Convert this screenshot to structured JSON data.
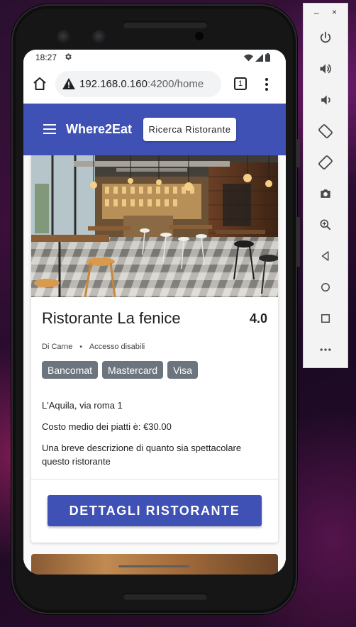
{
  "status_bar": {
    "time": "18:27"
  },
  "browser": {
    "url_host": "192.168.0.160",
    "url_path": ":4200/home",
    "tab_count": "1"
  },
  "app": {
    "title": "Where2Eat",
    "search_button": "Ricerca Ristorante"
  },
  "restaurant": {
    "name": "Ristorante La fenice",
    "rating": "4.0",
    "category": "Di Carne",
    "separator": "•",
    "accessibility": "Accesso disabili",
    "payments": [
      "Bancomat",
      "Mastercard",
      "Visa"
    ],
    "address": "L'Aquila, via roma 1",
    "average_cost": "Costo medio dei piatti è: €30.00",
    "description": "Una breve descrizione di quanto sia spettacolare questo ristorante",
    "details_button": "DETTAGLI RISTORANTE"
  },
  "emulator": {
    "minimize": "–",
    "close": "×",
    "buttons": [
      "power-icon",
      "volume-up-icon",
      "volume-down-icon",
      "rotate-left-icon",
      "rotate-right-icon",
      "camera-icon",
      "zoom-icon",
      "back-icon",
      "home-icon",
      "overview-icon",
      "more-icon"
    ]
  },
  "colors": {
    "primary": "#3f51b5",
    "chip": "#6c757d"
  }
}
